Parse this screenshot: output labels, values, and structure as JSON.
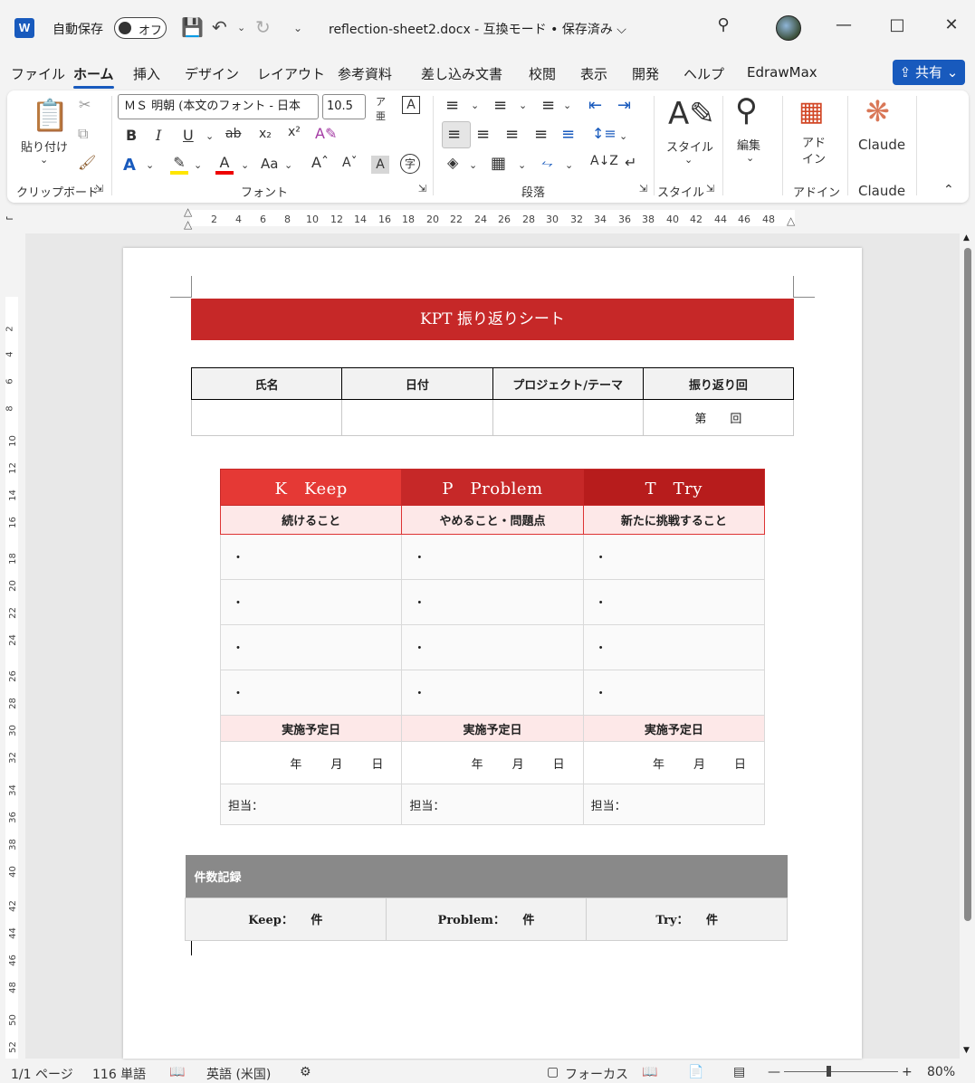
{
  "titlebar": {
    "app_icon": "W",
    "autosave_label": "自動保存",
    "autosave_state": "オフ",
    "doc_title": "reflection-sheet2.docx  -  互換モード • 保存済み ⌵"
  },
  "tabs": [
    "ファイル",
    "ホーム",
    "挿入",
    "デザイン",
    "レイアウト",
    "参考資料",
    "差し込み文書",
    "校閲",
    "表示",
    "開発",
    "ヘルプ",
    "EdrawMax"
  ],
  "share_label": "共有",
  "ribbon": {
    "paste_label": "貼り付け",
    "font_name": "ＭＳ 明朝 (本文のフォント - 日本",
    "font_size": "10.5",
    "style_label": "スタイル",
    "edit_label": "編集",
    "addin_label": "アド\nイン",
    "claude_label": "Claude",
    "groups": {
      "clipboard": "クリップボード",
      "font": "フォント",
      "paragraph": "段落",
      "style": "スタイル",
      "addin": "アドイン",
      "claude": "Claude"
    }
  },
  "ruler_numbers": [
    "2",
    "4",
    "6",
    "8",
    "10",
    "12",
    "14",
    "16",
    "18",
    "20",
    "22",
    "24",
    "26",
    "28",
    "30",
    "32",
    "34",
    "36",
    "38",
    "40",
    "42",
    "44",
    "46",
    "48"
  ],
  "vruler_numbers": [
    "2",
    "4",
    "6",
    "8",
    "10",
    "12",
    "14",
    "16",
    "18",
    "20",
    "22",
    "24",
    "26",
    "28",
    "30",
    "32",
    "34",
    "36",
    "38",
    "40",
    "42",
    "44",
    "46",
    "48",
    "50",
    "52"
  ],
  "document": {
    "banner": "KPT 振り返りシート",
    "info_headers": [
      "氏名",
      "日付",
      "プロジェクト/テーマ",
      "振り返り回"
    ],
    "round_text": "第　　回",
    "kpt_headers": [
      "K　Keep",
      "P　Problem",
      "T　Try"
    ],
    "kpt_header_colors": [
      "#e53935",
      "#c62828",
      "#b71c1c"
    ],
    "kpt_subheaders": [
      "続けること",
      "やめること・問題点",
      "新たに挑戦すること"
    ],
    "bullet": "・",
    "plan_label": "実施予定日",
    "date_text": "年　　月　　日",
    "owner_label": "担当：",
    "count_caption": "件数記録",
    "counts": [
      "Keep：　　件",
      "Problem：　　件",
      "Try：　　件"
    ]
  },
  "status": {
    "page": "1/1 ページ",
    "words": "116 単語",
    "language": "英語 (米国)",
    "focus": "フォーカス",
    "zoom": "80%"
  }
}
